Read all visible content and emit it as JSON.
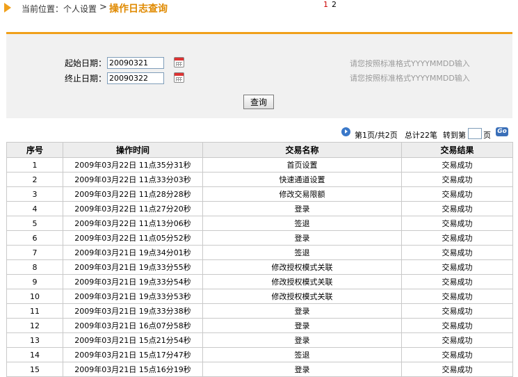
{
  "breadcrumb": {
    "prefix": "当前位置：个人设置",
    "separator": ">",
    "current": "操作日志查询"
  },
  "query": {
    "start_label": "起始日期：",
    "start_value": "20090321",
    "end_label": "终止日期：",
    "end_value": "20090322",
    "format_hint": "请您按照标准格式YYYYMMDD输入",
    "submit_label": "查询"
  },
  "pager": {
    "page_1": "1",
    "page_2": "2",
    "status": "第1页/共2页",
    "total": "总计22笔",
    "goto_prefix": "转到第",
    "goto_suffix": "页",
    "go_label": "Go"
  },
  "table": {
    "headers": [
      "序号",
      "操作时间",
      "交易名称",
      "交易结果"
    ],
    "rows": [
      [
        "1",
        "2009年03月22日 11点35分31秒",
        "首页设置",
        "交易成功"
      ],
      [
        "2",
        "2009年03月22日 11点33分03秒",
        "快速通道设置",
        "交易成功"
      ],
      [
        "3",
        "2009年03月22日 11点28分28秒",
        "修改交易限额",
        "交易成功"
      ],
      [
        "4",
        "2009年03月22日 11点27分20秒",
        "登录",
        "交易成功"
      ],
      [
        "5",
        "2009年03月22日 11点13分06秒",
        "签退",
        "交易成功"
      ],
      [
        "6",
        "2009年03月22日 11点05分52秒",
        "登录",
        "交易成功"
      ],
      [
        "7",
        "2009年03月21日 19点34分01秒",
        "签退",
        "交易成功"
      ],
      [
        "8",
        "2009年03月21日 19点33分55秒",
        "修改授权模式关联",
        "交易成功"
      ],
      [
        "9",
        "2009年03月21日 19点33分54秒",
        "修改授权模式关联",
        "交易成功"
      ],
      [
        "10",
        "2009年03月21日 19点33分53秒",
        "修改授权模式关联",
        "交易成功"
      ],
      [
        "11",
        "2009年03月21日 19点33分38秒",
        "登录",
        "交易成功"
      ],
      [
        "12",
        "2009年03月21日 16点07分58秒",
        "登录",
        "交易成功"
      ],
      [
        "13",
        "2009年03月21日 15点21分54秒",
        "登录",
        "交易成功"
      ],
      [
        "14",
        "2009年03月21日 15点17分47秒",
        "签退",
        "交易成功"
      ],
      [
        "15",
        "2009年03月21日 15点16分19秒",
        "登录",
        "交易成功"
      ]
    ]
  }
}
